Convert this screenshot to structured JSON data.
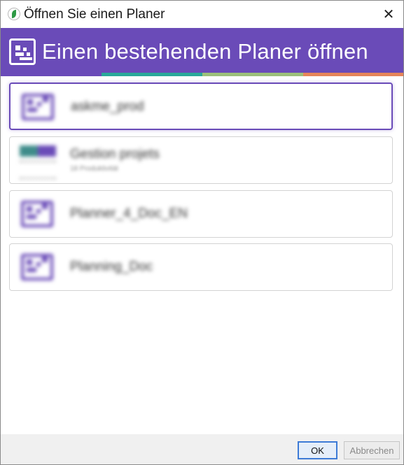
{
  "window": {
    "title": "Öffnen Sie einen Planer",
    "app_icon": "project-leaf-icon",
    "close_icon": "close-icon",
    "close_glyph": "✕"
  },
  "banner": {
    "icon": "planner-icon",
    "title": "Einen bestehenden Planer öffnen",
    "background_color": "#6a4bb8",
    "stripe_colors": [
      "#6a4bb8",
      "#2aa89a",
      "#9cc07a",
      "#e6855a"
    ]
  },
  "planners": [
    {
      "name": "askme_prod",
      "subtitle": "",
      "icon": "planner-icon",
      "selected": true
    },
    {
      "name": "Gestion projets",
      "subtitle": "18 Produktivität",
      "icon": "project-plan-icon",
      "selected": false
    },
    {
      "name": "Planner_4_Doc_EN",
      "subtitle": "",
      "icon": "planner-icon",
      "selected": false
    },
    {
      "name": "Planning_Doc",
      "subtitle": "",
      "icon": "planner-icon",
      "selected": false
    }
  ],
  "footer": {
    "ok_label": "OK",
    "cancel_label": "Abbrechen",
    "cancel_disabled": true
  }
}
